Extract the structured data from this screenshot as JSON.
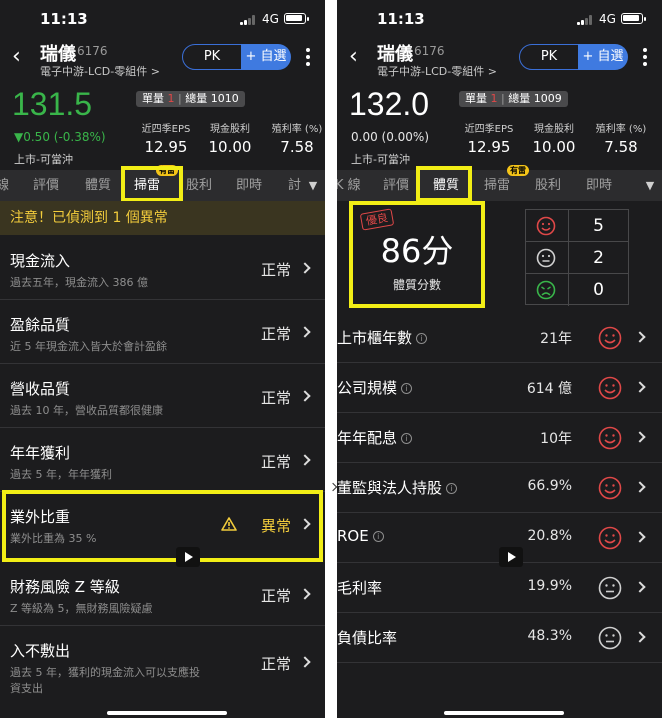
{
  "status": {
    "time": "11:13",
    "network": "4G"
  },
  "colors": {
    "up": "#39b54a",
    "accent": "#3f7ae0",
    "highlight": "#f2ee16",
    "warning": "#f2cc3c",
    "good_face": "#e04848"
  },
  "header": {
    "stock_name": "瑞儀",
    "stock_code": "6176",
    "industry": "電子中游-LCD-零組件 >",
    "pk_label": "PK",
    "add_label": "+ 自選"
  },
  "metrics": [
    {
      "label": "近四季EPS",
      "value": "12.95"
    },
    {
      "label": "現金股利",
      "value": "10.00"
    },
    {
      "label": "殖利率 (%)",
      "value": "7.58"
    }
  ],
  "left": {
    "price": "131.5",
    "change": "▼0.50 (-0.38%)",
    "market": "上市-可當沖",
    "volume": {
      "unit_label": "單量",
      "unit_value": "1",
      "total_label": "總量",
      "total_value": "1010"
    },
    "tabs": [
      {
        "label": "線"
      },
      {
        "label": "評價"
      },
      {
        "label": "體質"
      },
      {
        "label": "掃雷",
        "badge": "有雷"
      },
      {
        "label": "股利"
      },
      {
        "label": "即時"
      },
      {
        "label": "討"
      }
    ],
    "alert": "注意！已偵測到 1 個異常",
    "items": [
      {
        "title": "現金流入",
        "subtitle": "過去五年，現金流入 386 億",
        "status": "正常"
      },
      {
        "title": "盈餘品質",
        "subtitle": "近 5 年現金流入皆大於會計盈餘",
        "status": "正常"
      },
      {
        "title": "營收品質",
        "subtitle": "過去 10 年，營收品質都很健康",
        "status": "正常"
      },
      {
        "title": "年年獲利",
        "subtitle": "過去 5 年，年年獲利",
        "status": "正常"
      },
      {
        "title": "業外比重",
        "subtitle": "業外比重為 35 %",
        "status": "異常"
      },
      {
        "title": "財務風險 Z 等級",
        "subtitle": "Z 等級為 5，無財務風險疑慮",
        "status": "正常"
      },
      {
        "title": "入不敷出",
        "subtitle": "過去 5 年，獲利的現金流入可以支應投",
        "subtitle2": "資支出",
        "status": "正常"
      }
    ]
  },
  "right": {
    "price": "132.0",
    "change": "0.00 (0.00%)",
    "market": "上市-可當沖",
    "volume": {
      "unit_label": "單量",
      "unit_value": "1",
      "total_label": "總量",
      "total_value": "1009"
    },
    "tabs": [
      {
        "label": "K 線"
      },
      {
        "label": "評價"
      },
      {
        "label": "體質"
      },
      {
        "label": "掃雷",
        "badge": "有雷"
      },
      {
        "label": "股利"
      },
      {
        "label": "即時"
      }
    ],
    "score": {
      "stamp": "優良",
      "value": "86分",
      "label": "體質分數"
    },
    "counts": [
      {
        "face": "smile",
        "value": "5"
      },
      {
        "face": "neutral",
        "value": "2"
      },
      {
        "face": "frown",
        "value": "0"
      }
    ],
    "items": [
      {
        "title": "上市櫃年數",
        "value": "21年",
        "face": "smile"
      },
      {
        "title": "公司規模",
        "value": "614 億",
        "face": "smile"
      },
      {
        "title": "年年配息",
        "value": "10年",
        "face": "smile"
      },
      {
        "title": "董監與法人持股",
        "value": "66.9%",
        "face": "smile"
      },
      {
        "title": "ROE",
        "value": "20.8%",
        "face": "smile"
      },
      {
        "title": "毛利率",
        "value": "19.9%",
        "face": "neutral"
      },
      {
        "title": "負債比率",
        "value": "48.3%",
        "face": "neutral"
      }
    ]
  }
}
